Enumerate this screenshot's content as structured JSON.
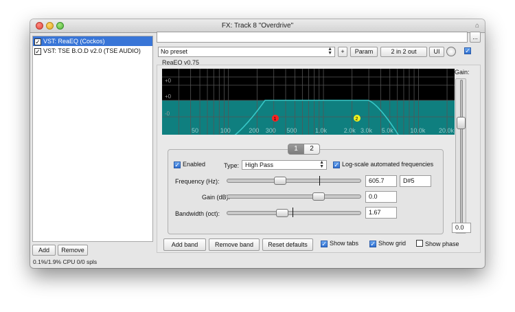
{
  "window": {
    "title": "FX: Track 8 \"Overdrive\"",
    "pin_icon": "pin-icon"
  },
  "fx_list": {
    "items": [
      {
        "label": "VST: ReaEQ (Cockos)",
        "checked": true,
        "selected": true
      },
      {
        "label": "VST: TSE B.O.D v2.0 (TSE AUDIO)",
        "checked": true,
        "selected": false
      }
    ],
    "add_label": "Add",
    "remove_label": "Remove",
    "cpu": "0.1%/1.9% CPU 0/0 spls"
  },
  "toolbar": {
    "dots_label": "...",
    "preset_value": "No preset",
    "plus_label": "+",
    "param_label": "Param",
    "io_label": "2 in 2 out",
    "ui_label": "UI"
  },
  "plugin": {
    "name": "ReaEQ v0.75",
    "gain_label": "Gain:",
    "gain_value": "0.0",
    "graph": {
      "db_labels": [
        "+0",
        "+0",
        "-0"
      ],
      "freq_labels": [
        "50",
        "100",
        "200",
        "300",
        "500",
        "1.0k",
        "2.0k",
        "3.0k",
        "5.0k",
        "10.0k",
        "20.0k"
      ],
      "band_points": [
        {
          "num": "1",
          "color": "#ff2020"
        },
        {
          "num": "2",
          "color": "#f0f020"
        }
      ],
      "fill_color": "#0f7f7f",
      "curve_color": "#38c8c8"
    },
    "tabs": [
      "1",
      "2"
    ],
    "enabled_label": "Enabled",
    "type_label": "Type:",
    "type_value": "High Pass",
    "log_scale_label": "Log-scale automated frequencies",
    "frequency_label": "Frequency (Hz):",
    "frequency_value": "605.7",
    "note_value": "D#5",
    "gain_db_label": "Gain (dB):",
    "gain_db_value": "0.0",
    "bandwidth_label": "Bandwidth (oct):",
    "bandwidth_value": "1.67",
    "add_band_label": "Add band",
    "remove_band_label": "Remove band",
    "reset_label": "Reset defaults",
    "show_tabs_label": "Show tabs",
    "show_grid_label": "Show grid",
    "show_phase_label": "Show phase"
  }
}
